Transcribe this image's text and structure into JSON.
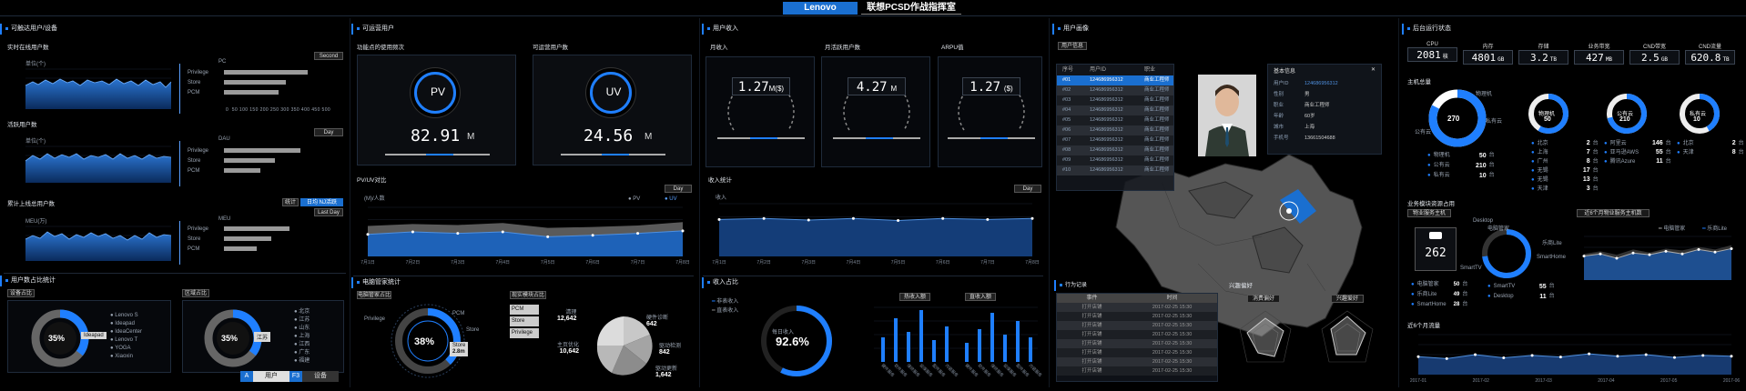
{
  "header": {
    "brand": "Lenovo",
    "title": "联想PCSD作战指挥室"
  },
  "col1": {
    "section": "可触达用户/设备",
    "r1": {
      "title": "实时在线用户数",
      "btn": "Second",
      "left_label": "单位(个)",
      "right_label": "PC",
      "cats": [
        "Privilege",
        "Store",
        "PCM"
      ],
      "vals": [
        0.85,
        0.63,
        0.55
      ],
      "ticks": [
        "0",
        "50",
        "100",
        "150",
        "200",
        "250",
        "300",
        "350",
        "400",
        "450",
        "500"
      ],
      "axis": [
        "180",
        "160",
        "140",
        "120",
        "100",
        "80",
        "60",
        "40",
        "20",
        "0"
      ]
    },
    "r2": {
      "title": "活跃用户数",
      "btn": "Day",
      "left_label": "单位(个)",
      "right_label": "DAU",
      "cats": [
        "Privilege",
        "Store",
        "PCM"
      ],
      "vals": [
        0.78,
        0.52,
        0.36
      ]
    },
    "r3": {
      "title": "累计上线总用户数",
      "btn1": "统计",
      "btn2": "日均 NJ活跃",
      "btn3": "Last Day",
      "left_label": "MEU(万)",
      "right_label": "MEU",
      "cats": [
        "Privilege",
        "Store",
        "PCM"
      ],
      "vals": [
        0.66,
        0.48,
        0.33
      ]
    },
    "dist": {
      "title": "用户数占比统计",
      "sub1": "设备占比",
      "sub2": "区域占比",
      "p1": "35%",
      "p2": "35%",
      "tip1": "Ideapad",
      "tip2": "江苏",
      "legend1": [
        "Lenovo S",
        "Ideapad",
        "IdeaCenter",
        "Lenovo T",
        "YOGA",
        "Xiaoxin"
      ],
      "legend2": [
        "北京",
        "江苏",
        "山东",
        "上海",
        "江西",
        "广东",
        "福建"
      ],
      "tab_a": "A",
      "tab_user": "用户",
      "tab_f": "F3",
      "tab_dev": "设备"
    }
  },
  "col2": {
    "section": "可运营用户",
    "kpi1": {
      "title": "功能点的使用频次",
      "badge": "PV",
      "value": "82.91",
      "unit": "M"
    },
    "kpi2": {
      "title": "可运营用户数",
      "badge": "UV",
      "value": "24.56",
      "unit": "M"
    },
    "pvuv": {
      "title": "PV/UV对比",
      "btn": "Day",
      "unit": "(M)/人数",
      "legend": [
        "PV",
        "UV"
      ],
      "ticks": [
        "7月1日",
        "7月2日",
        "7月3日",
        "7月4日",
        "7月5日",
        "7月6日",
        "7月7日",
        "7月8日"
      ],
      "pv": [
        0.62,
        0.66,
        0.64,
        0.68,
        0.58,
        0.6,
        0.63,
        0.7
      ],
      "uv": [
        0.45,
        0.5,
        0.47,
        0.5,
        0.4,
        0.43,
        0.47,
        0.52
      ]
    },
    "share": {
      "title": "电脑管家统计",
      "sub1": "电脑管家占比",
      "sub2": "现实模块占比",
      "pct": "38%",
      "labels": [
        "Privilege",
        "PCM",
        "Store"
      ],
      "tip_name": "Store",
      "tip_val": "2.8m",
      "stack": [
        "PCM",
        "Store",
        "Privilege"
      ],
      "pie": [
        {
          "name": "清理",
          "val": "12,642"
        },
        {
          "name": "硬件诊断",
          "val": "642"
        },
        {
          "name": "主页优化",
          "val": "10,642"
        },
        {
          "name": "驱动检测",
          "val": "842"
        },
        {
          "name": "驱动更新",
          "val": "1,642"
        }
      ]
    }
  },
  "col3": {
    "section": "用户收入",
    "g1": {
      "title": "月收入",
      "value": "1.27",
      "unit": "M($)"
    },
    "g2": {
      "title": "月活跃用户数",
      "value": "4.27",
      "unit": "M"
    },
    "g3": {
      "title": "ARPU值",
      "value": "1.27",
      "unit": "($)"
    },
    "inc": {
      "title": "收入统计",
      "btn": "Day",
      "unit": "收入",
      "ticks": [
        "7月1日",
        "7月2日",
        "7月3日",
        "7月4日",
        "7月5日",
        "7月6日",
        "7月7日",
        "7月8日"
      ],
      "vals": [
        0.7,
        0.72,
        0.69,
        0.72,
        0.68,
        0.72,
        0.7,
        0.72
      ]
    },
    "ratio": {
      "title": "收入占比",
      "legend": [
        "非表收入",
        "直表收入"
      ],
      "center_title": "每日收入",
      "pct": "92.6%",
      "sub1": "热收入额",
      "sub2": "直收入额",
      "bars1": [
        0.45,
        0.8,
        0.55,
        0.95,
        0.4,
        0.65
      ],
      "bars2": [
        0.35,
        0.6,
        0.9,
        0.5,
        0.75,
        0.45
      ],
      "cats": [
        "硬件服务",
        "软件服务",
        "保修服务",
        "延保服务",
        "配件服务",
        "内容服务"
      ]
    }
  },
  "col4": {
    "section": "用户画像",
    "panel": "用户信息",
    "table": {
      "head": [
        "序号",
        "用户ID",
        "职业"
      ],
      "rows": [
        [
          "#01",
          "124686956312",
          "商业工程师"
        ],
        [
          "#02",
          "124686956312",
          "商业工程师"
        ],
        [
          "#03",
          "124686956312",
          "商业工程师"
        ],
        [
          "#04",
          "124686956312",
          "商业工程师"
        ],
        [
          "#05",
          "124686956312",
          "商业工程师"
        ],
        [
          "#06",
          "124686956312",
          "商业工程师"
        ],
        [
          "#07",
          "124686956312",
          "商业工程师"
        ],
        [
          "#08",
          "124686956312",
          "商业工程师"
        ],
        [
          "#09",
          "124686956312",
          "商业工程师"
        ],
        [
          "#10",
          "124686956312",
          "商业工程师"
        ]
      ]
    },
    "card": {
      "title": "基本信息",
      "fields": [
        [
          "用户ID",
          "124686956312"
        ],
        [
          "性别",
          "男"
        ],
        [
          "职业",
          "商业工程师"
        ],
        [
          "年龄",
          "60岁"
        ],
        [
          "城市",
          "上海"
        ],
        [
          "手机号",
          "13661504688"
        ]
      ]
    },
    "behavior": {
      "title": "行为记录",
      "head": [
        "事件",
        "时间"
      ],
      "rows": [
        [
          "打开店铺",
          "2017-02-25 15:30"
        ],
        [
          "打开店铺",
          "2017-02-25 15:30"
        ],
        [
          "打开店铺",
          "2017-02-25 15:30"
        ],
        [
          "打开店铺",
          "2017-02-25 15:30"
        ],
        [
          "打开店铺",
          "2017-02-25 15:30"
        ],
        [
          "打开店铺",
          "2017-02-25 15:30"
        ],
        [
          "打开店铺",
          "2017-02-25 15:30"
        ],
        [
          "打开店铺",
          "2017-02-25 15:30"
        ]
      ]
    },
    "radar": {
      "title": "兴趣偏好",
      "l": "消费偏好",
      "r": "兴趣爱好"
    }
  },
  "col5": {
    "section": "后台运行状态",
    "res": [
      {
        "n": "CPU",
        "v": "2081",
        "u": "核"
      },
      {
        "n": "内存",
        "v": "4801",
        "u": "GB"
      },
      {
        "n": "存储",
        "v": "3.2",
        "u": "TB"
      },
      {
        "n": "业务带宽",
        "v": "427",
        "u": "MB"
      },
      {
        "n": "CND带宽",
        "v": "2.5",
        "u": "GB"
      },
      {
        "n": "CND流量",
        "v": "620.8",
        "u": "TB"
      }
    ],
    "host": {
      "title": "主机总量",
      "donut1": {
        "label": "物理机",
        "v": "270"
      },
      "a": "公有云",
      "b": "私有云",
      "list1": [
        [
          "物理机",
          "50"
        ],
        [
          "公有云",
          "210"
        ],
        [
          "私有云",
          "10"
        ]
      ],
      "unit": "台",
      "d2": "物理机",
      "d2v": "50",
      "list2": [
        [
          "北京",
          "2"
        ],
        [
          "上海",
          "7"
        ],
        [
          "广州",
          "8"
        ],
        [
          "无锡",
          "17"
        ],
        [
          "无锡",
          "13"
        ],
        [
          "天津",
          "3"
        ]
      ],
      "d3": "公有云",
      "d3v": "210",
      "list3": [
        [
          "阿里云",
          "146"
        ],
        [
          "亚马逊AWS",
          "55"
        ],
        [
          "腾讯Azure",
          "11"
        ]
      ],
      "d4": "私有云",
      "d4v": "10",
      "list4": [
        [
          "北京",
          "2"
        ],
        [
          "天津",
          "8"
        ]
      ]
    },
    "biz": {
      "title": "业务模块资源占用",
      "sub": "物业服务主机",
      "count": "262",
      "labels": [
        "电脑管家",
        "乐商Lite",
        "SmartHome"
      ],
      "vals": [
        "50",
        "49",
        "28"
      ],
      "ring": [
        "电脑管家",
        "乐商Lite",
        "SmartHome",
        "SmartTV",
        "Desktop"
      ],
      "r_list": [
        [
          "SmartTV",
          "55"
        ],
        [
          "Desktop",
          "11"
        ]
      ],
      "trend": "近6个月物业服务主机数",
      "legend": [
        "电脑管家",
        "乐商Lite"
      ],
      "area_t": [
        "2017-01",
        "2017-02",
        "2017-03",
        "2017-04",
        "2017-05",
        "2017-06"
      ]
    },
    "flow": {
      "title": "近6个月流量",
      "t": [
        "2017-01",
        "2017-02",
        "2017-03",
        "2017-04",
        "2017-05",
        "2017-06"
      ]
    }
  }
}
